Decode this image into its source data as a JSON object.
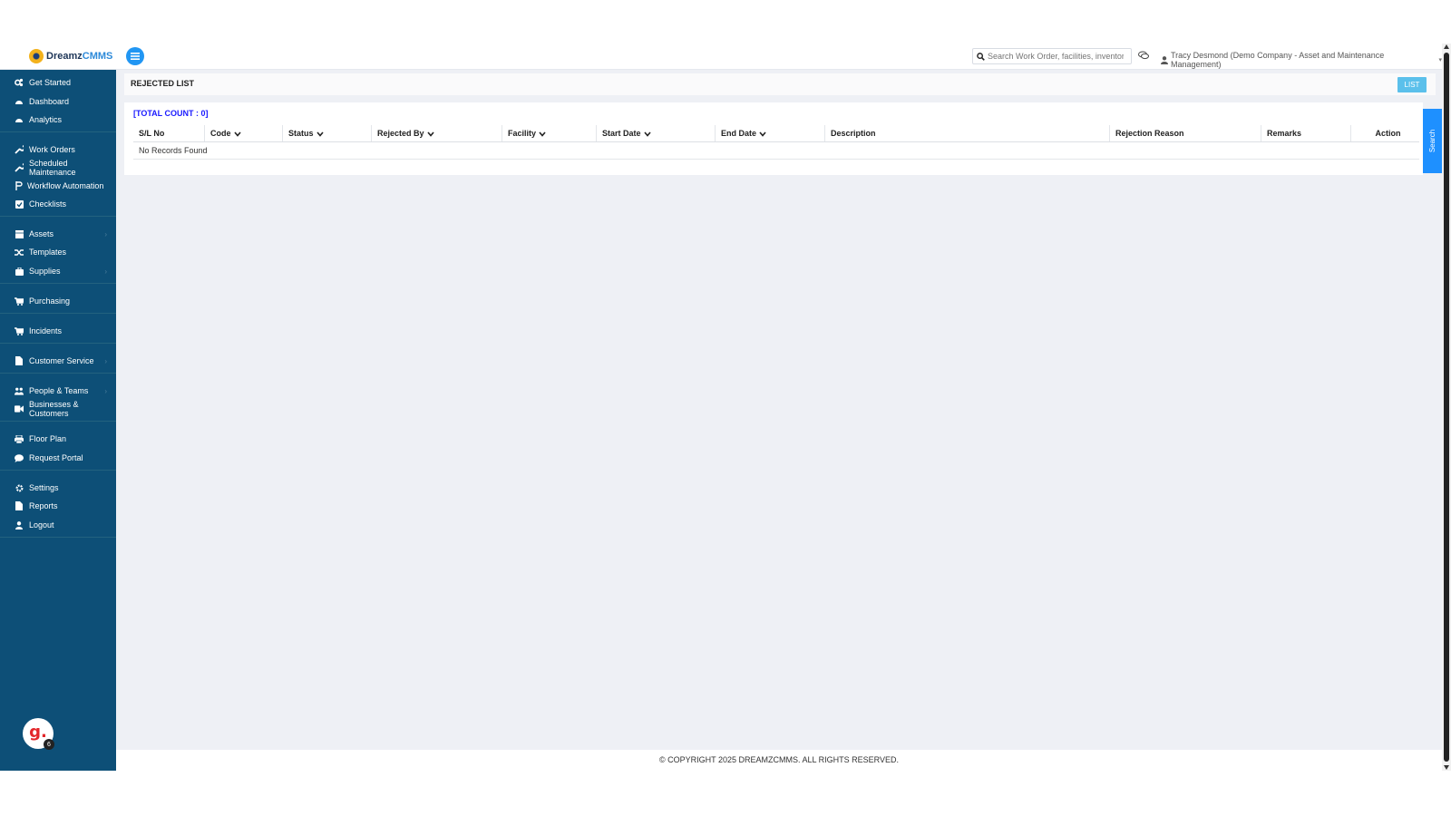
{
  "app": {
    "logo_text_primary": "Dreamz",
    "logo_text_accent": "CMMS",
    "search_placeholder": "Search Work Order, facilities, inventory",
    "user_label": "Tracy Desmond (Demo Company - Asset and Maintenance Management)"
  },
  "sidebar": {
    "items": [
      {
        "label": "Get Started",
        "icon": "cogs-icon"
      },
      {
        "label": "Dashboard",
        "icon": "dashboard-icon"
      },
      {
        "label": "Analytics",
        "icon": "analytics-icon"
      },
      {
        "label": "Work Orders",
        "icon": "wrench-icon"
      },
      {
        "label": "Scheduled Maintenance",
        "icon": "wrench-icon"
      },
      {
        "label": "Workflow Automation",
        "icon": "flow-icon"
      },
      {
        "label": "Checklists",
        "icon": "checkbox-icon"
      },
      {
        "label": "Assets",
        "icon": "table-icon"
      },
      {
        "label": "Templates",
        "icon": "shuffle-icon"
      },
      {
        "label": "Supplies",
        "icon": "box-icon"
      },
      {
        "label": "Purchasing",
        "icon": "cart-icon"
      },
      {
        "label": "Incidents",
        "icon": "cart-icon"
      },
      {
        "label": "Customer Service",
        "icon": "file-icon"
      },
      {
        "label": "People & Teams",
        "icon": "users-icon"
      },
      {
        "label": "Businesses & Customers",
        "icon": "video-icon"
      },
      {
        "label": "Floor Plan",
        "icon": "print-icon"
      },
      {
        "label": "Request Portal",
        "icon": "comment-icon"
      },
      {
        "label": "Settings",
        "icon": "gear-icon"
      },
      {
        "label": "Reports",
        "icon": "file-icon"
      },
      {
        "label": "Logout",
        "icon": "user-icon"
      }
    ],
    "badge_letter": "g.",
    "badge_count": "6"
  },
  "main": {
    "page_title": "REJECTED LIST",
    "list_button": "LIST",
    "total_count": "[TOTAL COUNT : 0]",
    "columns": [
      "S/L No",
      "Code",
      "Status",
      "Rejected By",
      "Facility",
      "Start Date",
      "End Date",
      "Description",
      "Rejection Reason",
      "Remarks",
      "Action"
    ],
    "empty_message": "No Records Found",
    "search_tab": "Search"
  },
  "footer": {
    "text": "© COPYRIGHT 2025 DREAMZCMMS. ALL RIGHTS RESERVED."
  },
  "colors": {
    "sidebar_bg": "#0d4f77",
    "accent": "#2196f3",
    "list_button": "#5bc0eb",
    "total_count": "#1a1aff"
  }
}
